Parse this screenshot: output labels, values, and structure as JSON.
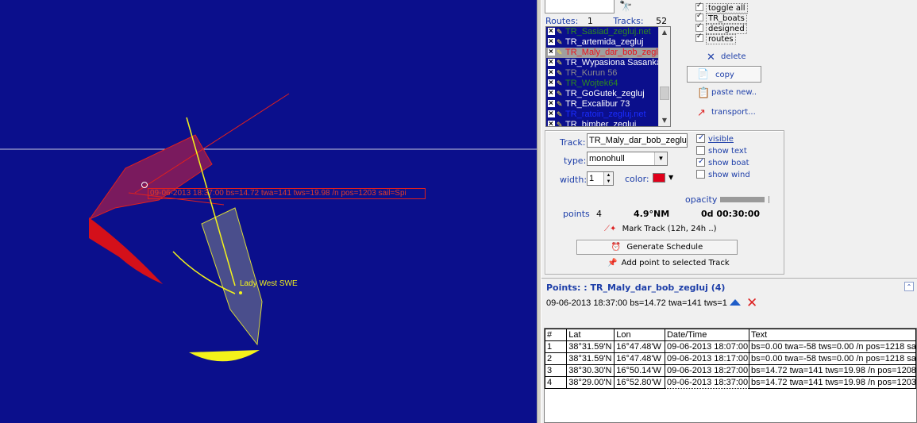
{
  "map": {
    "track_label": "09-06-2013 18:37:00 bs=14.72 twa=141 tws=19.98 /n pos=1203 sail=Spi",
    "boat_name": "Lady West SWE"
  },
  "routes_label": "Routes:",
  "routes_count": "1",
  "tracks_label": "Tracks:",
  "tracks_count": "52",
  "track_list": [
    {
      "name": "TR_Sasiad_zegluj.net",
      "color": "#2e8b1e",
      "selected": false
    },
    {
      "name": "TR_artemida_zegluj",
      "color": "#ffffff",
      "selected": false
    },
    {
      "name": "TR_Maly_dar_bob_zegluj",
      "color": "#e8141e",
      "selected": true
    },
    {
      "name": "TR_Wypasiona Sasanka",
      "color": "#ffffff",
      "selected": false
    },
    {
      "name": "TR_Kurun 56",
      "color": "#8a8a8a",
      "selected": false
    },
    {
      "name": "TR_Wojtek64",
      "color": "#2e8b1e",
      "selected": false
    },
    {
      "name": "TR_GoGutek_zegluj",
      "color": "#ffffff",
      "selected": false
    },
    {
      "name": "TR_Excalibur 73",
      "color": "#ffffff",
      "selected": false
    },
    {
      "name": "TR_ratoin_zegluj.net",
      "color": "#1a2cff",
      "selected": false
    },
    {
      "name": "TR_bimber_zegluj",
      "color": "#ffffff",
      "selected": false
    }
  ],
  "toggles": [
    {
      "label": "toggle all"
    },
    {
      "label": "TR_boats"
    },
    {
      "label": "designed"
    },
    {
      "label": "routes"
    }
  ],
  "actions": {
    "delete": "delete",
    "copy": "copy",
    "paste": "paste new..",
    "transport": "transport..."
  },
  "props": {
    "track_label": "Track:",
    "track_value": "TR_Maly_dar_bob_zegluj",
    "type_label": "type:",
    "type_value": "monohull",
    "width_label": "width:",
    "width_value": "1",
    "color_label": "color:",
    "color_value": "#e0001a",
    "visible": "visible",
    "show_text": "show text",
    "show_boat": "show boat",
    "show_wind": "show wind",
    "opacity_label": "opacity",
    "points_label": "points",
    "points_value": "4",
    "distance": "4.9°NM",
    "duration": "0d 00:30:00",
    "mark_track": "Mark Track (12h, 24h ..)",
    "generate_schedule": "Generate Schedule",
    "add_point": "Add point to selected Track"
  },
  "points": {
    "title": "Points: : TR_Maly_dar_bob_zegluj (4)",
    "edit_value": "09-06-2013 18:37:00 bs=14.72 twa=141 tws=1",
    "columns": [
      "#",
      "Lat",
      "Lon",
      "Date/Time",
      "Text"
    ],
    "rows": [
      [
        "1",
        "38°31.59'N",
        "16°47.48'W",
        "09-06-2013 18:07:00",
        "bs=0.00 twa=-58 tws=0.00 /n pos=1218 sail"
      ],
      [
        "2",
        "38°31.59'N",
        "16°47.48'W",
        "09-06-2013 18:17:00",
        "bs=0.00 twa=-58 tws=0.00 /n pos=1218 sail"
      ],
      [
        "3",
        "38°30.30'N",
        "16°50.14'W",
        "09-06-2013 18:27:00",
        "bs=14.72 twa=141 tws=19.98 /n pos=1208"
      ],
      [
        "4",
        "38°29.00'N",
        "16°52.80'W",
        "09-06-2013 18:37:00",
        "bs=14.72 twa=141 tws=19.98 /n pos=1203"
      ]
    ]
  }
}
